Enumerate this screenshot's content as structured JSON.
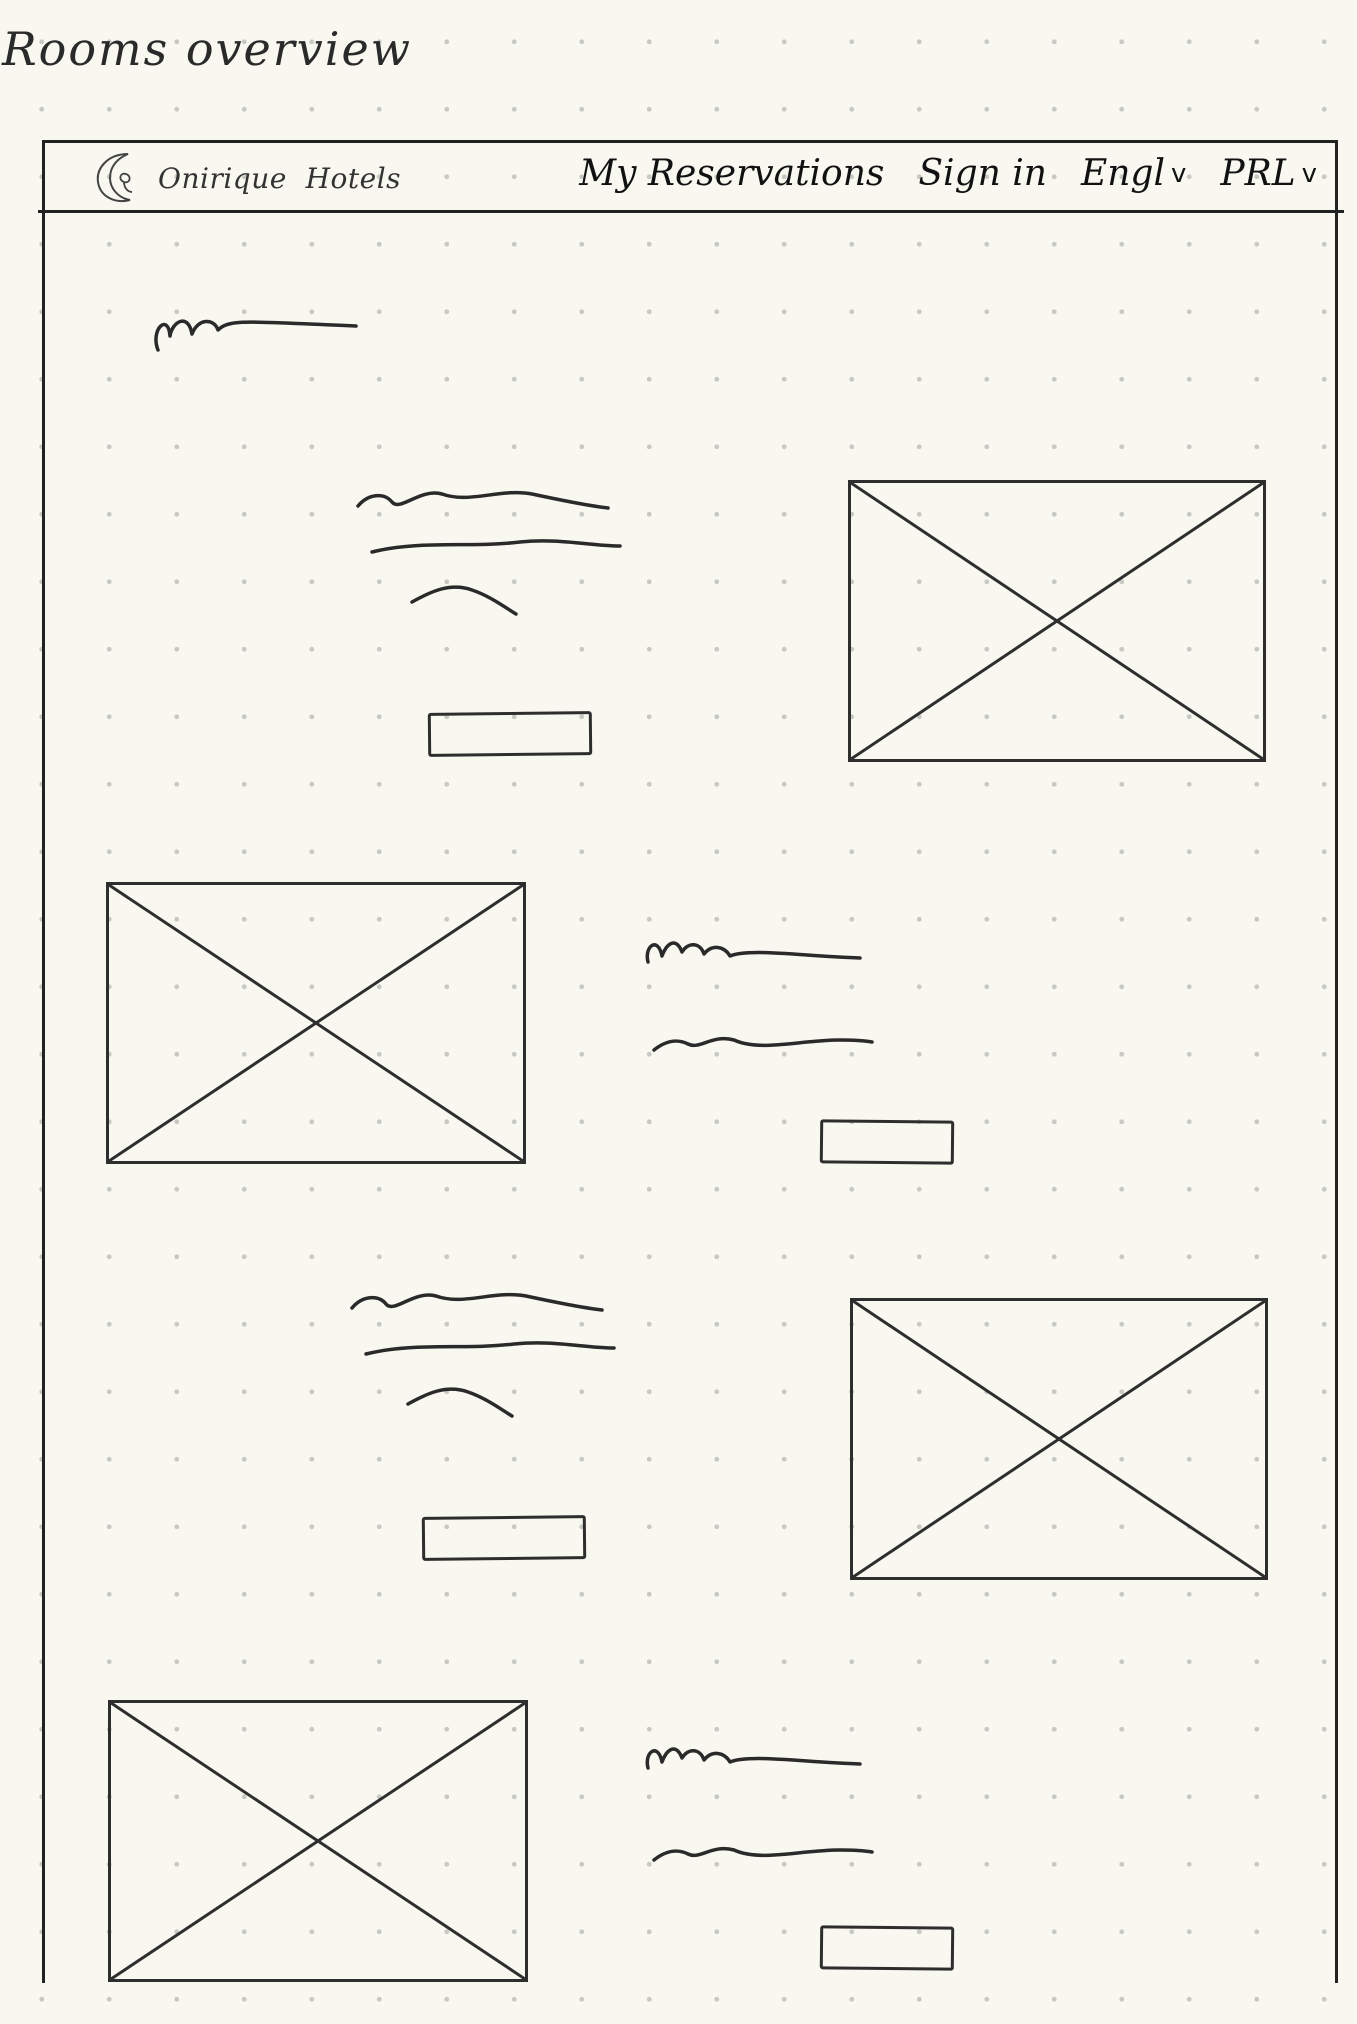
{
  "page_title": "Rooms overview",
  "header": {
    "brand": "Onirique  Hotels",
    "nav": {
      "reservations": "My Reservations",
      "sign_in": "Sign in",
      "language": "Engl",
      "currency": "PRL"
    },
    "chevron": "v"
  },
  "room_cards": [
    {
      "layout": "text-left-image-right",
      "placeholder_icon": "image-placeholder-x"
    },
    {
      "layout": "image-left-text-right",
      "placeholder_icon": "image-placeholder-x"
    },
    {
      "layout": "text-left-image-right",
      "placeholder_icon": "image-placeholder-x"
    },
    {
      "layout": "image-left-text-right",
      "placeholder_icon": "image-placeholder-x"
    }
  ],
  "colors": {
    "paper": "#f8f7f0",
    "ink": "#2e2e2e",
    "dots": "#c9c9c4"
  }
}
